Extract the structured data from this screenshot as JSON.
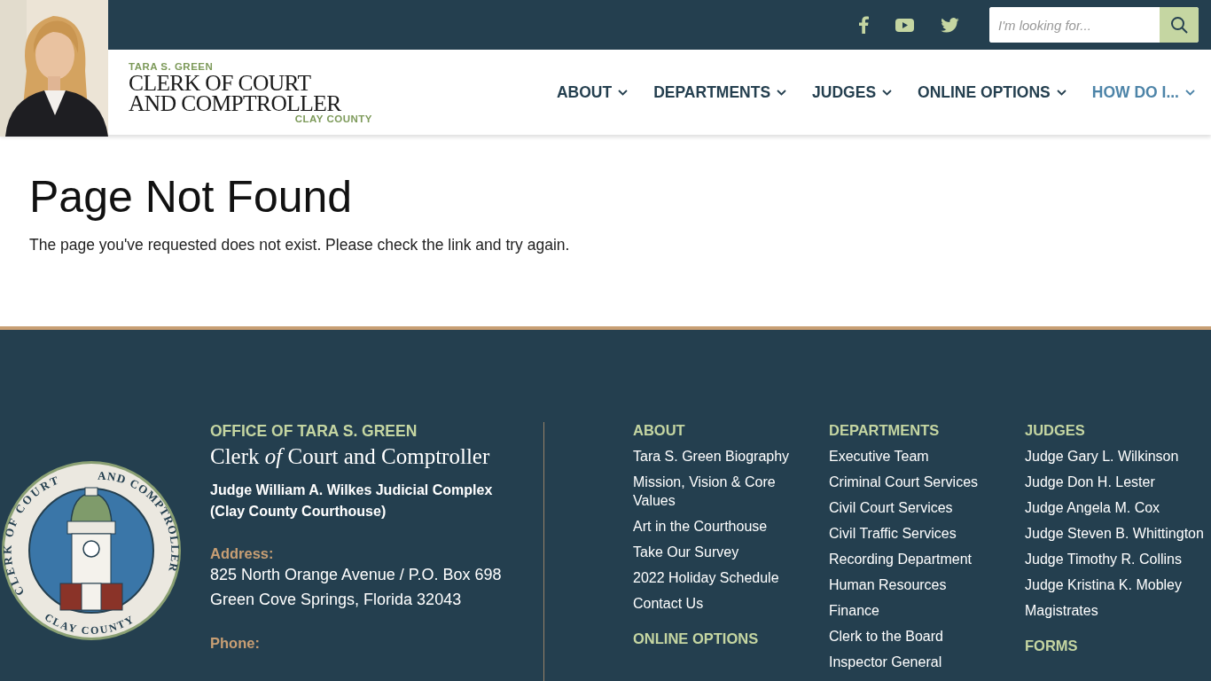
{
  "header": {
    "logo": {
      "name": "TARA S. GREEN",
      "title_line_1": "CLERK OF COURT",
      "title_line_2": "AND COMPTROLLER",
      "county": "CLAY COUNTY"
    },
    "search": {
      "placeholder": "I'm looking for..."
    },
    "nav": [
      {
        "label": "ABOUT",
        "selected": false
      },
      {
        "label": "DEPARTMENTS",
        "selected": false
      },
      {
        "label": "JUDGES",
        "selected": false
      },
      {
        "label": "ONLINE OPTIONS",
        "selected": false
      },
      {
        "label": "HOW DO I...",
        "selected": true
      }
    ]
  },
  "main": {
    "title": "Page Not Found",
    "message": "The page you've requested does not exist. Please check the link and try again."
  },
  "footer": {
    "seal": {
      "arc_left": "CLERK OF COURT",
      "arc_right": "AND COMPTROLLER",
      "arc_bottom": "CLAY COUNTY"
    },
    "office": {
      "heading": "OFFICE OF TARA S. GREEN",
      "title": "Clerk *of* Court and Comptroller",
      "building": "Judge William A. Wilkes Judicial Complex (Clay County Courthouse)",
      "address_label": "Address:",
      "address_lines": [
        "825 North Orange Avenue / P.O. Box 698",
        "Green Cove Springs, Florida 32043"
      ],
      "phone_label": "Phone:"
    },
    "columns": [
      {
        "sections": [
          {
            "heading": "ABOUT",
            "links": [
              "Tara S. Green Biography",
              "Mission, Vision & Core Values",
              "Art in the Courthouse",
              "Take Our Survey",
              "2022 Holiday Schedule",
              "Contact Us"
            ]
          },
          {
            "heading": "ONLINE OPTIONS"
          }
        ]
      },
      {
        "sections": [
          {
            "heading": "DEPARTMENTS",
            "links": [
              "Executive Team",
              "Criminal Court Services",
              "Civil Court Services",
              "Civil Traffic Services",
              "Recording Department",
              "Human Resources",
              "Finance",
              "Clerk to the Board",
              "Inspector General"
            ]
          }
        ]
      },
      {
        "sections": [
          {
            "heading": "JUDGES",
            "links": [
              "Judge Gary L. Wilkinson",
              "Judge Don H. Lester",
              "Judge Angela M. Cox",
              "Judge Steven B. Whittington",
              "Judge Timothy R. Collins",
              "Judge Kristina K. Mobley",
              "Magistrates"
            ]
          },
          {
            "heading": "FORMS"
          }
        ]
      }
    ]
  }
}
